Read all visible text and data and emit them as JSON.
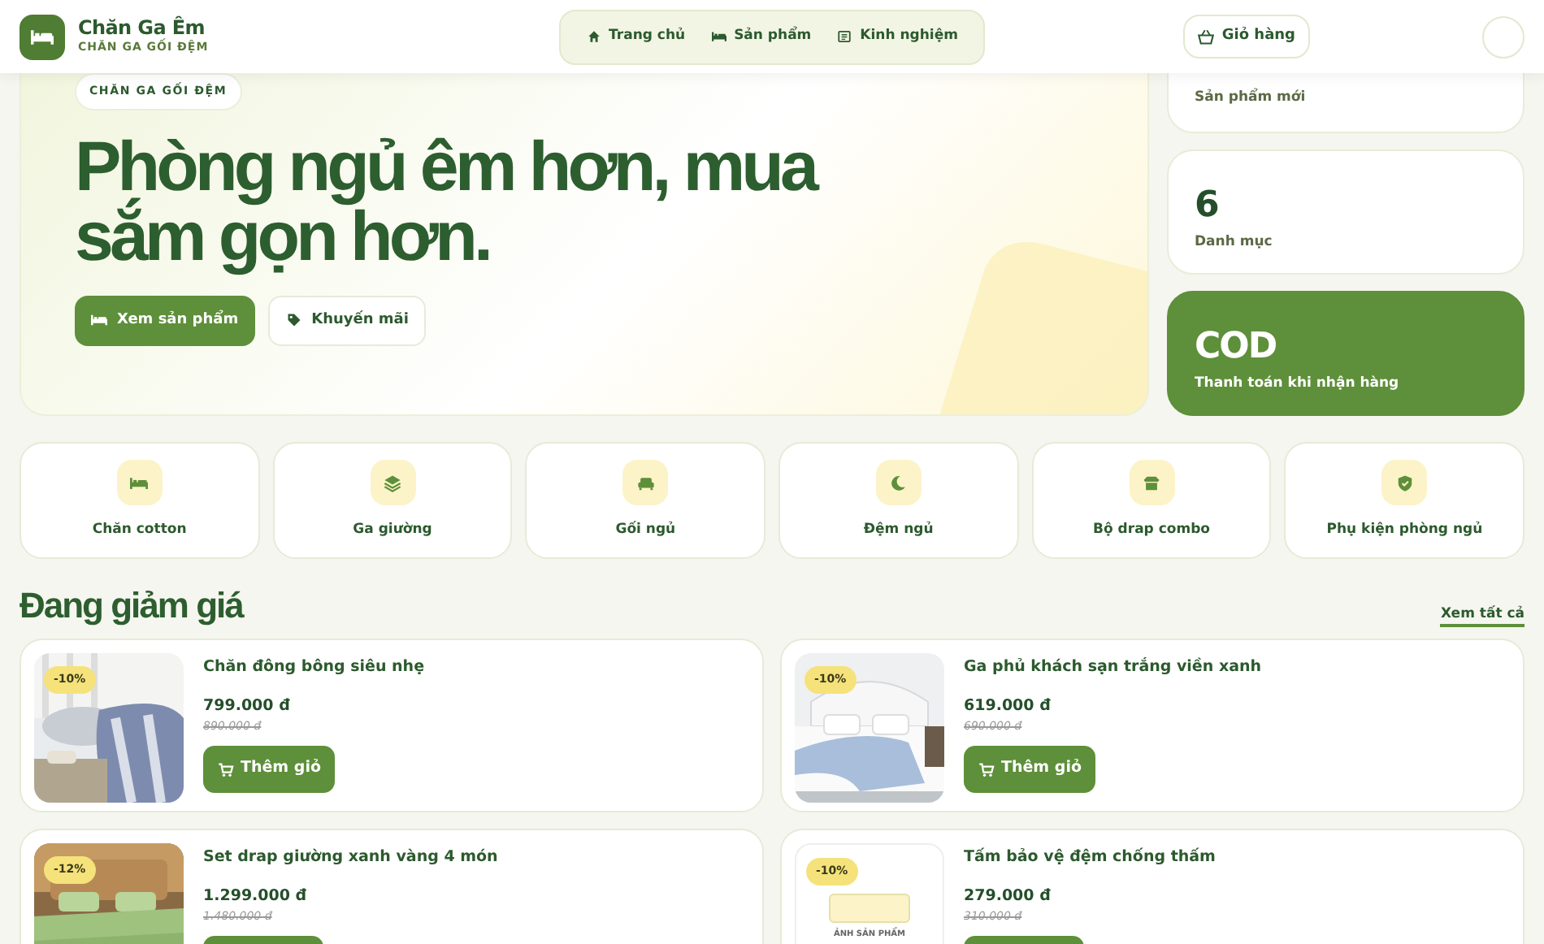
{
  "brand": {
    "name": "Chăn Ga Êm",
    "tagline": "CHĂN GA GỐI ĐỆM"
  },
  "nav": [
    {
      "label": "Trang chủ"
    },
    {
      "label": "Sản phẩm"
    },
    {
      "label": "Kinh nghiệm"
    }
  ],
  "cart": {
    "label": "Giỏ hàng"
  },
  "hero": {
    "eyebrow": "CHĂN GA GỐI ĐỆM",
    "title": "Phòng ngủ êm hơn, mua sắm gọn hơn.",
    "buttons": [
      {
        "label": "Xem sản phẩm",
        "kind": "primary"
      },
      {
        "label": "Khuyến mãi",
        "kind": "outline"
      }
    ]
  },
  "stats": [
    {
      "label": "Sản phẩm mới",
      "kind": "light"
    },
    {
      "value": "6",
      "label": "Danh mục",
      "kind": "light"
    },
    {
      "value": "COD",
      "label": "Thanh toán khi nhận hàng",
      "kind": "accent"
    }
  ],
  "categories": [
    {
      "label": "Chăn cotton"
    },
    {
      "label": "Ga giường"
    },
    {
      "label": "Gối ngủ"
    },
    {
      "label": "Đệm ngủ"
    },
    {
      "label": "Bộ drap combo"
    },
    {
      "label": "Phụ kiện phòng ngủ"
    }
  ],
  "sale_section": {
    "title": "Đang giảm giá",
    "link": "Xem tất cả"
  },
  "products": [
    {
      "name": "Chăn đông bông siêu nhẹ",
      "price": "799.000 đ",
      "old_price": "890.000 đ",
      "discount": "-10%",
      "button": "Thêm giỏ"
    },
    {
      "name": "Ga phủ khách sạn trắng viền xanh",
      "price": "619.000 đ",
      "old_price": "690.000 đ",
      "discount": "-10%",
      "button": "Thêm giỏ"
    },
    {
      "name": "Set drap giường xanh vàng 4 món",
      "price": "1.299.000 đ",
      "old_price": "1.480.000 đ",
      "discount": "-12%"
    },
    {
      "name": "Tấm bảo vệ đệm chống thấm",
      "price": "279.000 đ",
      "old_price": "310.000 đ",
      "discount": "-10%",
      "kind": "placeholder",
      "placeholder_text": "ẢNH SẢN PHẨM"
    }
  ]
}
